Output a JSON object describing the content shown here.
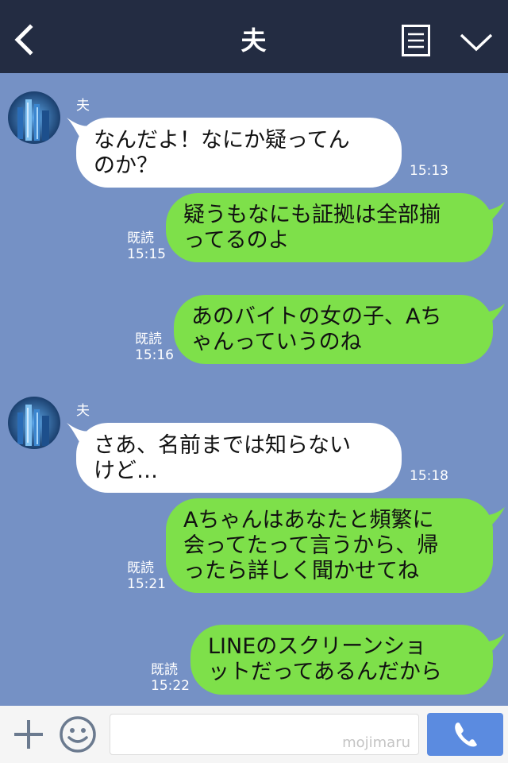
{
  "header": {
    "title": "夫"
  },
  "messages": [
    {
      "type": "in",
      "sender": "夫",
      "lines": [
        "なんだよ！なにか疑ってん",
        "のか？"
      ],
      "time": "15:13"
    },
    {
      "type": "out",
      "read": "既読",
      "time": "15:15",
      "lines": [
        "疑うもなにも証拠は全部揃",
        "ってるのよ"
      ]
    },
    {
      "type": "out",
      "read": "既読",
      "time": "15:16",
      "lines": [
        "あのバイトの女の子、Aち",
        "ゃんっていうのね"
      ]
    },
    {
      "type": "in",
      "sender": "夫",
      "lines": [
        "さあ、名前までは知らない",
        "けど…"
      ],
      "time": "15:18"
    },
    {
      "type": "out",
      "read": "既読",
      "time": "15:21",
      "lines": [
        "Aちゃんはあなたと頻繁に",
        "会ってたって言うから、帰",
        "ったら詳しく聞かせてね"
      ]
    },
    {
      "type": "out",
      "read": "既読",
      "time": "15:22",
      "lines": [
        "LINEのスクリーンショ",
        "ットだってあるんだから"
      ]
    }
  ],
  "footer": {
    "watermark": "mojimaru"
  },
  "icons": {
    "back": "chevron-left-icon",
    "menu": "document-menu-icon",
    "collapse": "chevron-down-icon",
    "plus": "plus-icon",
    "emoji": "smiley-icon",
    "call": "phone-icon"
  },
  "colors": {
    "header": "#232c42",
    "chat_bg": "#7591c5",
    "bubble_in": "#ffffff",
    "bubble_out": "#7ee04a",
    "call_button": "#5b8be0"
  }
}
